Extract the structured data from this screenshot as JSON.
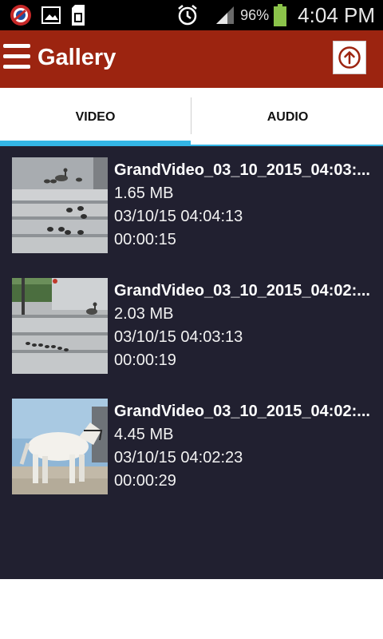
{
  "status_bar": {
    "battery_percent": "96%",
    "time": "4:04 PM",
    "icons": [
      "app-notification-icon",
      "image-icon",
      "sd-card-icon",
      "alarm-icon",
      "signal-icon",
      "battery-icon"
    ]
  },
  "app_bar": {
    "title": "Gallery",
    "background": "#9c2410",
    "icons": [
      "menu-icon",
      "upload-icon"
    ]
  },
  "tabs": [
    {
      "label": "VIDEO",
      "selected": true
    },
    {
      "label": "AUDIO",
      "selected": false
    }
  ],
  "accent": "#33b5e5",
  "videos": [
    {
      "title": "GrandVideo_03_10_2015_04:03:...",
      "size": "1.65 MB",
      "date": "03/10/15 04:04:13",
      "duration": "00:00:15"
    },
    {
      "title": "GrandVideo_03_10_2015_04:02:...",
      "size": "2.03 MB",
      "date": "03/10/15 04:03:13",
      "duration": "00:00:19"
    },
    {
      "title": "GrandVideo_03_10_2015_04:02:...",
      "size": "4.45 MB",
      "date": "03/10/15 04:02:23",
      "duration": "00:00:29"
    }
  ]
}
